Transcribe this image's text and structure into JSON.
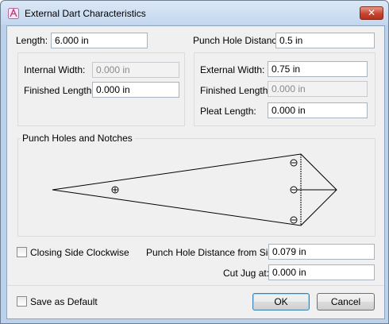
{
  "window": {
    "title": "External Dart Characteristics",
    "close_label": "✕"
  },
  "top": {
    "length_label": "Length:",
    "length_value": "6.000 in",
    "punch_hole_distance_label": "Punch Hole Distance:",
    "punch_hole_distance_value": "0.5 in"
  },
  "internal": {
    "width_label": "Internal Width:",
    "width_value": "0.000 in",
    "finished_length_label": "Finished Length:",
    "finished_length_value": "0.000 in"
  },
  "external": {
    "width_label": "External Width:",
    "width_value": "0.75 in",
    "finished_length_label": "Finished Length:",
    "finished_length_value": "0.000 in",
    "pleat_length_label": "Pleat Length:",
    "pleat_length_value": "0.000 in"
  },
  "preview": {
    "title": "Punch Holes and Notches"
  },
  "bottom": {
    "closing_side_label": "Closing Side Clockwise",
    "closing_side_checked": false,
    "side_distance_label": "Punch Hole Distance from Side:",
    "side_distance_value": "0.079 in",
    "cut_jug_label": "Cut Jug at:",
    "cut_jug_value": "0.000 in",
    "save_default_label": "Save as Default",
    "save_default_checked": false,
    "ok_label": "OK",
    "cancel_label": "Cancel"
  }
}
